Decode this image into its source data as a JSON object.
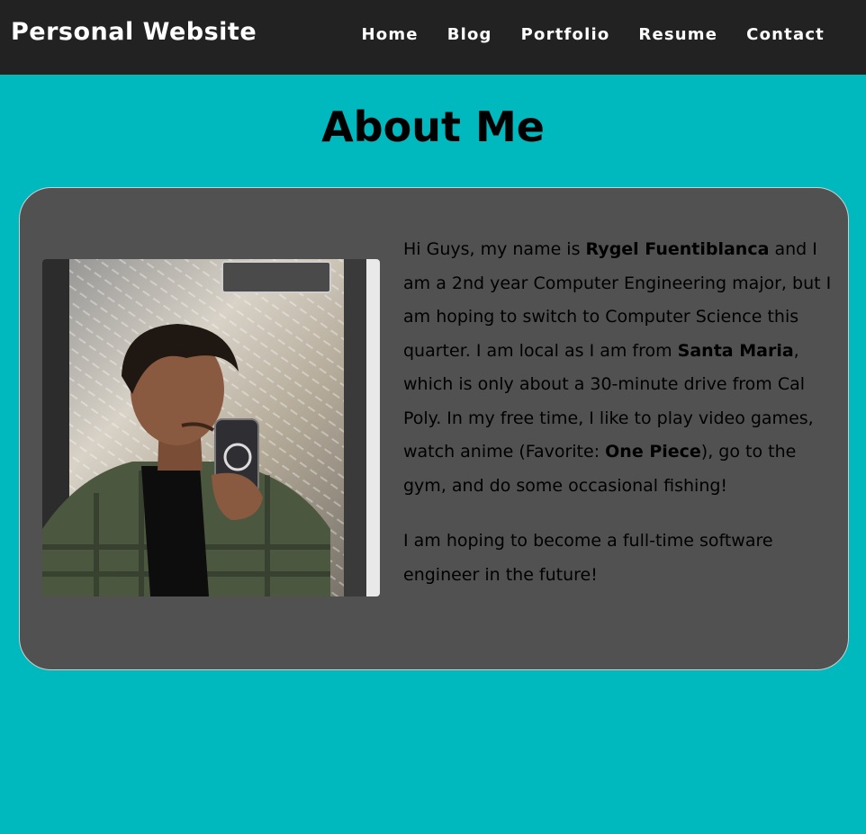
{
  "header": {
    "site_title": "Personal Website",
    "nav": [
      {
        "label": "Home"
      },
      {
        "label": "Blog"
      },
      {
        "label": "Portfolio"
      },
      {
        "label": "Resume"
      },
      {
        "label": "Contact"
      }
    ]
  },
  "main": {
    "heading": "About Me",
    "bio": {
      "p1": {
        "intro": "Hi Guys, my name is ",
        "name": "Rygel Fuentiblanca",
        "mid1": " and I am a 2nd year Computer Engineering major, but I am hoping to switch to Computer Science this quarter. I am local as I am from ",
        "hometown": "Santa Maria",
        "mid2": ", which is only about a 30-minute drive from Cal Poly. In my free time, I like to play video games, watch anime (Favorite: ",
        "favorite_anime": "One Piece",
        "end": "), go to the gym, and do some occasional fishing!"
      },
      "p2": "I am hoping to become a full-time software engineer in the future!"
    }
  },
  "colors": {
    "page_background": "#00b9be",
    "navbar_background": "#222222",
    "card_background": "#515151",
    "nav_text": "#ffffff",
    "body_text": "#000000"
  }
}
